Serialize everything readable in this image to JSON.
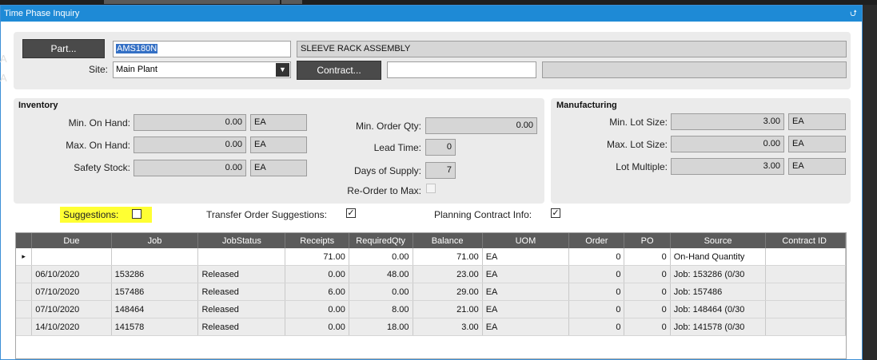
{
  "window": {
    "title": "Time Phase Inquiry",
    "pin_icon": "pin-icon"
  },
  "header": {
    "part_button": "Part...",
    "part_value": "AMS180N",
    "part_description": "SLEEVE RACK ASSEMBLY",
    "site_label": "Site:",
    "site_value": "Main Plant",
    "contract_button": "Contract...",
    "contract_value": "",
    "contract_description": ""
  },
  "inventory": {
    "title": "Inventory",
    "min_on_hand_label": "Min. On Hand:",
    "min_on_hand": "0.00",
    "min_on_hand_uom": "EA",
    "max_on_hand_label": "Max. On Hand:",
    "max_on_hand": "0.00",
    "max_on_hand_uom": "EA",
    "safety_stock_label": "Safety Stock:",
    "safety_stock": "0.00",
    "safety_stock_uom": "EA",
    "min_order_qty_label": "Min. Order Qty:",
    "min_order_qty": "0.00",
    "lead_time_label": "Lead Time:",
    "lead_time": "0",
    "days_of_supply_label": "Days of Supply:",
    "days_of_supply": "7",
    "reorder_to_max_label": "Re-Order to Max:",
    "reorder_to_max_checked": false
  },
  "manufacturing": {
    "title": "Manufacturing",
    "min_lot_size_label": "Min. Lot Size:",
    "min_lot_size": "3.00",
    "min_lot_size_uom": "EA",
    "max_lot_size_label": "Max. Lot Size:",
    "max_lot_size": "0.00",
    "max_lot_size_uom": "EA",
    "lot_multiple_label": "Lot Multiple:",
    "lot_multiple": "3.00",
    "lot_multiple_uom": "EA"
  },
  "options": {
    "suggestions_label": "Suggestions:",
    "suggestions_checked": false,
    "transfer_label": "Transfer Order Suggestions:",
    "transfer_checked": true,
    "planning_label": "Planning Contract Info:",
    "planning_checked": true
  },
  "grid": {
    "columns": [
      "Due",
      "Job",
      "JobStatus",
      "Receipts",
      "RequiredQty",
      "Balance",
      "UOM",
      "Order",
      "PO",
      "Source",
      "Contract ID"
    ],
    "rows": [
      [
        "",
        "",
        "",
        "71.00",
        "0.00",
        "71.00",
        "EA",
        "0",
        "0",
        "On-Hand Quantity",
        ""
      ],
      [
        "06/10/2020",
        "153286",
        "Released",
        "0.00",
        "48.00",
        "23.00",
        "EA",
        "0",
        "0",
        "Job: 153286 (0/30",
        ""
      ],
      [
        "07/10/2020",
        "157486",
        "Released",
        "6.00",
        "0.00",
        "29.00",
        "EA",
        "0",
        "0",
        "Job: 157486",
        ""
      ],
      [
        "07/10/2020",
        "148464",
        "Released",
        "0.00",
        "8.00",
        "21.00",
        "EA",
        "0",
        "0",
        "Job: 148464 (0/30",
        ""
      ],
      [
        "14/10/2020",
        "141578",
        "Released",
        "0.00",
        "18.00",
        "3.00",
        "EA",
        "0",
        "0",
        "Job: 141578 (0/30",
        ""
      ]
    ],
    "row_indicator": "▸"
  },
  "background": {
    "left_text_1": "A",
    "left_text_2": "A"
  }
}
